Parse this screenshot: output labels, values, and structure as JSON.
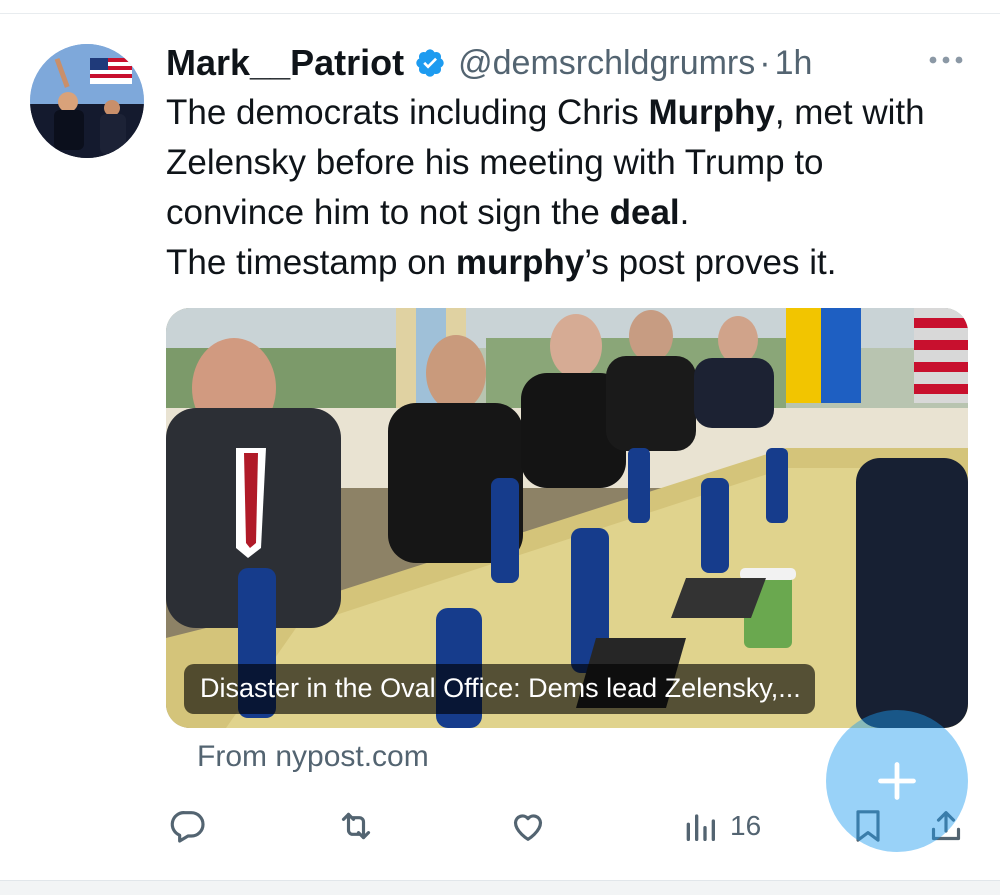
{
  "tweet": {
    "display_name": "Mark__Patriot",
    "handle": "@demsrchldgrumrs",
    "separator": "·",
    "time": "1h",
    "text_segments": [
      {
        "t": "The democrats including Chris ",
        "bold": false
      },
      {
        "t": "Murphy",
        "bold": true
      },
      {
        "t": ", met with Zelensky before his meeting with Trump to convince him to not sign the ",
        "bold": false
      },
      {
        "t": "deal",
        "bold": true
      },
      {
        "t": ".",
        "bold": false
      },
      {
        "t": "\n",
        "bold": false
      },
      {
        "t": "The timestamp on ",
        "bold": false
      },
      {
        "t": "murphy",
        "bold": true
      },
      {
        "t": "’s post proves it.",
        "bold": false
      }
    ]
  },
  "card": {
    "caption": "Disaster in the Oval Office: Dems lead Zelensky,...",
    "source": "From nypost.com"
  },
  "actions": {
    "views_count": "16"
  },
  "icons": {
    "verified": "verified-badge-icon",
    "more": "more-icon",
    "reply": "reply-icon",
    "retweet": "retweet-icon",
    "like": "like-icon",
    "views": "views-icon",
    "bookmark": "bookmark-icon",
    "share": "share-icon",
    "compose": "plus-icon"
  },
  "colors": {
    "accent": "#1d9bf0",
    "text": "#0f1419",
    "secondary": "#536471"
  }
}
